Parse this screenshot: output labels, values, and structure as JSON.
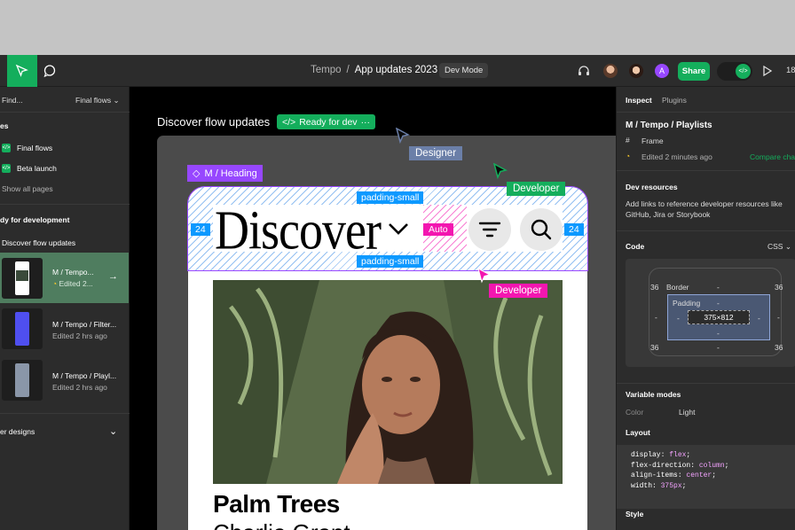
{
  "header": {
    "project": "Tempo",
    "file": "App updates 2023",
    "mode_badge": "Dev Mode",
    "share_label": "Share",
    "zoom_partial": "18",
    "avatar_letter": "A",
    "accent": "#14ae5c"
  },
  "left_panel": {
    "find_label": "Find...",
    "filter_label": "Final flows",
    "section_partial": "es",
    "pages": [
      {
        "label": "Final flows"
      },
      {
        "label": "Beta launch"
      }
    ],
    "show_all": "Show all pages",
    "ready_heading": "dy for development",
    "group_title": "Discover flow updates",
    "items": [
      {
        "title": "M / Tempo...",
        "meta": "Edited 2..."
      },
      {
        "title": "M / Tempo / Filter...",
        "meta": "Edited 2 hrs ago"
      },
      {
        "title": "M / Tempo / Playl...",
        "meta": "Edited 2 hrs ago"
      }
    ],
    "other_section": "er designs"
  },
  "canvas": {
    "flow_title": "Discover flow updates",
    "ready_badge": "Ready for dev",
    "heading_tag": "M / Heading",
    "discover_word": "Discover",
    "padding_top": "padding-small",
    "padding_bottom": "padding-small",
    "left_num": "24",
    "right_num": "24",
    "auto_label": "Auto",
    "cursor_designer": "Designer",
    "cursor_developer_1": "Developer",
    "cursor_developer_2": "Developer",
    "card_title": "Palm Trees",
    "card_subtitle": "Charlie Grant",
    "colors": {
      "designer": "#6b7fa8",
      "developer_green": "#14ae5c",
      "developer_pink": "#f316b0",
      "spacing": "#0d99ff",
      "component": "#9747ff"
    }
  },
  "right_panel": {
    "tabs": [
      {
        "label": "Inspect"
      },
      {
        "label": "Plugins"
      }
    ],
    "selection_path": "M / Tempo / Playlists",
    "selection_type": "Frame",
    "edited": "Edited 2 minutes ago",
    "compare": "Compare char",
    "dev_resources_title": "Dev resources",
    "dev_resources_text_1": "Add links to reference developer resources like",
    "dev_resources_text_2": "GitHub, Jira or Storybook",
    "code_title": "Code",
    "code_lang": "CSS",
    "box": {
      "border_label": "Border",
      "padding_label": "Padding",
      "size": "375×812",
      "tl": "36",
      "tr": "36",
      "bl": "36",
      "br": "36",
      "dash": "-"
    },
    "variable_modes_title": "Variable modes",
    "color_key": "Color",
    "color_value": "Light",
    "layout_title": "Layout",
    "code_lines": [
      {
        "prop": "display",
        "val": "flex"
      },
      {
        "prop": "flex-direction",
        "val": "column"
      },
      {
        "prop": "align-items",
        "val": "center"
      },
      {
        "prop": "width",
        "val": "375px"
      }
    ],
    "style_title": "Style"
  }
}
